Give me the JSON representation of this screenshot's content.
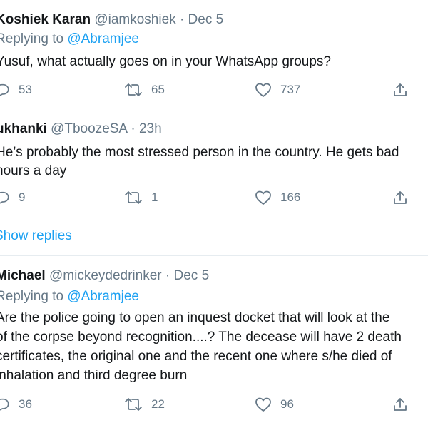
{
  "tweets": [
    {
      "name": "Koshiek Karan",
      "handle": "@iamkoshiek",
      "sep": "·",
      "date": "Dec 5",
      "replying_prefix": "Replying to",
      "replying_to": "@Abramjee",
      "body_lines": [
        "Yusuf, what actually goes on in your WhatsApp groups?"
      ],
      "replies": "53",
      "retweets": "65",
      "likes": "737"
    },
    {
      "name": "ukhanki",
      "handle": "@TboozeSA",
      "sep": "·",
      "date": "23h",
      "body_lines": [
        "He’s probably the most stressed person in the country. He gets bad",
        "hours a day"
      ],
      "replies": "9",
      "retweets": "1",
      "likes": "166"
    },
    {
      "name": "Michael",
      "handle": "@mickeydedrinker",
      "sep": "·",
      "date": "Dec 5",
      "replying_prefix": "Replying to",
      "replying_to": "@Abramjee",
      "body_lines": [
        "Are the police going to open an inquest docket that will look at the",
        "of the corpse beyond recognition....? The decease will have 2 death",
        "certificates, the original one and the recent one where s/he died of",
        "inhalation and third degree burn"
      ],
      "replies": "36",
      "retweets": "22",
      "likes": "96"
    }
  ],
  "show_replies": "Show replies",
  "colors": {
    "link": "#1da1f2",
    "muted": "#657786",
    "text": "#14171a"
  }
}
